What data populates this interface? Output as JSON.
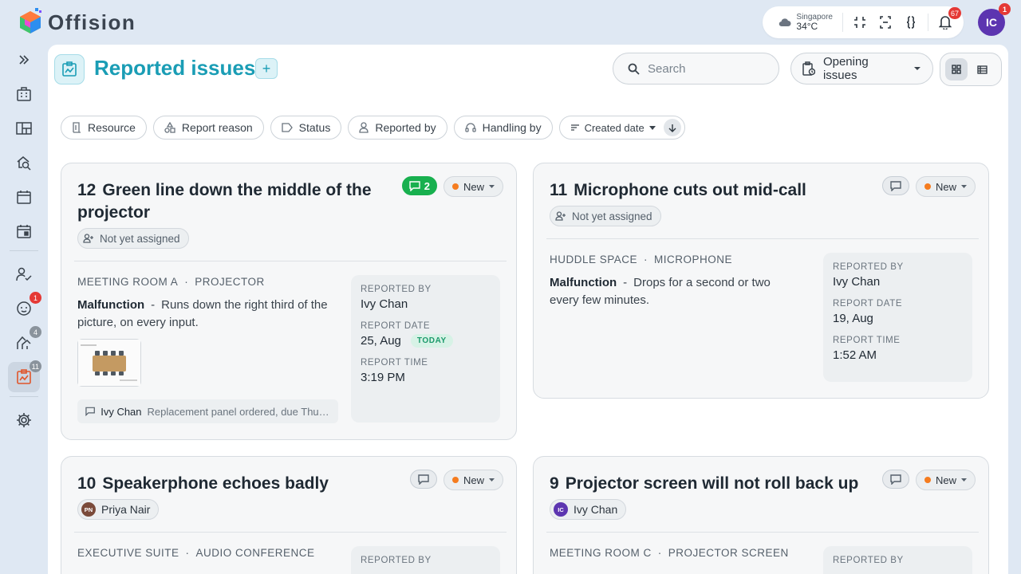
{
  "app": {
    "name": "Offision"
  },
  "topbar": {
    "weather": {
      "city": "Singapore",
      "temp": "34°C"
    },
    "notifications_count": "67",
    "user_initials": "IC",
    "user_badge": "1"
  },
  "sidebar": {
    "items": [
      {
        "icon": "expand-icon"
      },
      {
        "icon": "building-icon"
      },
      {
        "icon": "floorplan-icon"
      },
      {
        "icon": "search-place-icon"
      },
      {
        "icon": "calendar-icon"
      },
      {
        "icon": "calendar-event-icon"
      },
      {
        "icon": "user-check-icon"
      },
      {
        "icon": "visitor-icon",
        "badge": "1"
      },
      {
        "icon": "handling-icon",
        "badge": "4"
      },
      {
        "icon": "reported-issues-icon",
        "badge": "11"
      },
      {
        "icon": "settings-icon"
      }
    ]
  },
  "header": {
    "title": "Reported issues",
    "add_label": "+",
    "search_placeholder": "Search",
    "filter_select": "Opening issues"
  },
  "filters": {
    "resource": "Resource",
    "report_reason": "Report reason",
    "status": "Status",
    "reported_by": "Reported by",
    "handling_by": "Handling by",
    "sort": "Created date"
  },
  "labels": {
    "reported_by": "REPORTED BY",
    "report_date": "REPORT DATE",
    "report_time": "REPORT TIME",
    "today": "TODAY",
    "separator_dot": "·",
    "separator_dash": "-"
  },
  "issues": [
    {
      "number": "12",
      "title": "Green line down the middle of the projector",
      "comments": "2",
      "status": "New",
      "assignee": "Not yet assigned",
      "location": "MEETING ROOM A",
      "resource": "PROJECTOR",
      "reason": "Malfunction",
      "description": "Runs down the right third of the picture, on every input.",
      "reported_by": "Ivy Chan",
      "report_date": "25, Aug",
      "report_time": "3:19 PM",
      "last_comment_author": "Ivy Chan",
      "last_comment_text": "Replacement panel ordered, due Thursd..."
    },
    {
      "number": "11",
      "title": "Microphone cuts out mid-call",
      "status": "New",
      "assignee": "Not yet assigned",
      "location": "HUDDLE SPACE",
      "resource": "MICROPHONE",
      "reason": "Malfunction",
      "description": "Drops for a second or two every few minutes.",
      "reported_by": "Ivy Chan",
      "report_date": "19, Aug",
      "report_time": "1:52 AM"
    },
    {
      "number": "10",
      "title": "Speakerphone echoes badly",
      "status": "New",
      "assignee": "Priya Nair",
      "assignee_initials": "PN",
      "location": "EXECUTIVE SUITE",
      "resource": "AUDIO CONFERENCE"
    },
    {
      "number": "9",
      "title": "Projector screen will not roll back up",
      "status": "New",
      "assignee": "Ivy Chan",
      "assignee_initials": "IC",
      "location": "MEETING ROOM C",
      "resource": "PROJECTOR SCREEN"
    }
  ]
}
